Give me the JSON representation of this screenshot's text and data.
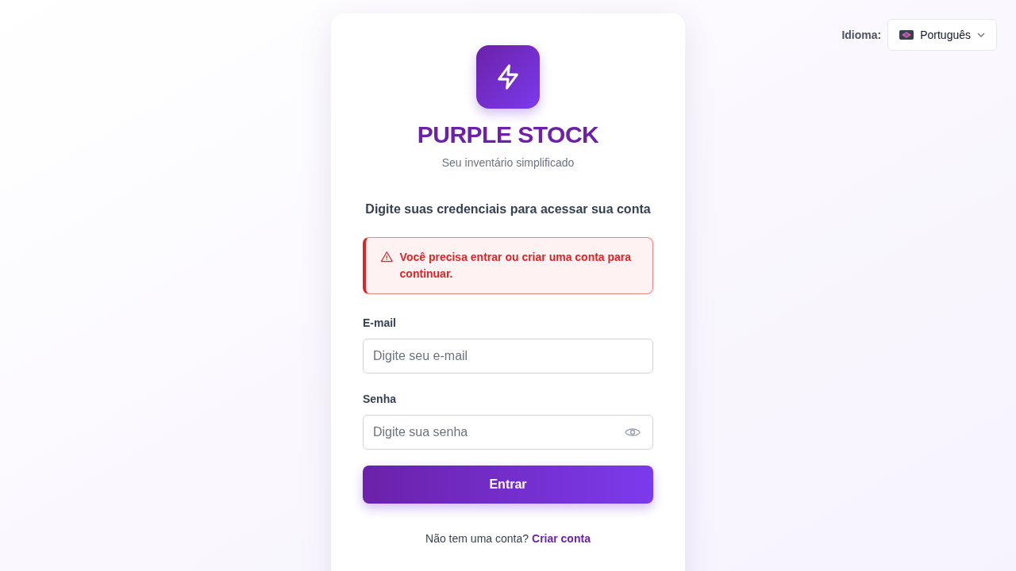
{
  "language": {
    "label": "Idioma:",
    "value": "Português"
  },
  "brand": {
    "name": "PURPLE STOCK",
    "tagline": "Seu inventário simplificado"
  },
  "intro": "Digite suas credenciais para acessar sua conta",
  "alert": {
    "message": "Você precisa entrar ou criar uma conta para continuar."
  },
  "fields": [
    {
      "kind": "email",
      "label": "E-mail",
      "placeholder": "Digite seu e-mail"
    },
    {
      "kind": "password",
      "label": "Senha",
      "placeholder": "Digite sua senha"
    }
  ],
  "submit": "Entrar",
  "signup": {
    "text": "Não tem uma conta?",
    "link": "Criar conta"
  }
}
